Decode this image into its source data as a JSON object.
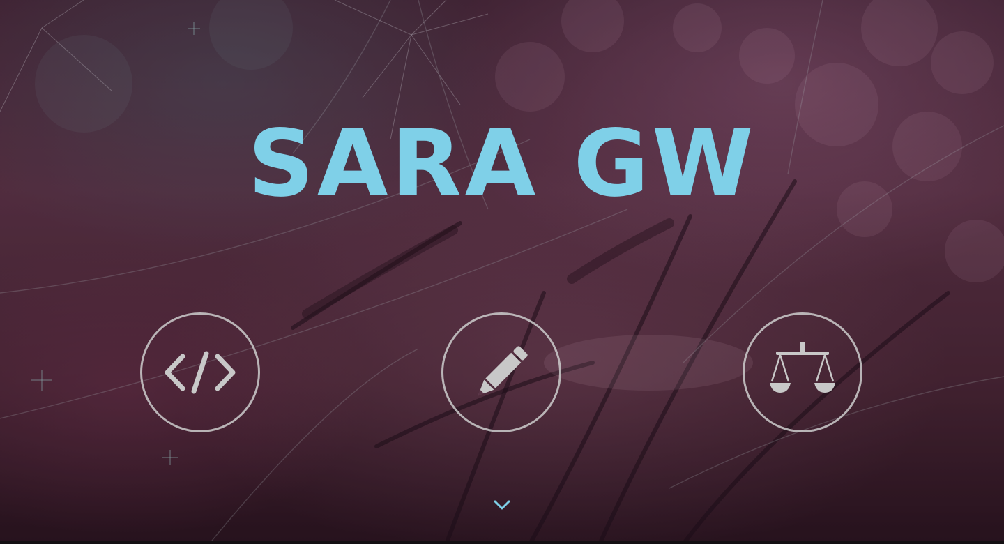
{
  "hero": {
    "title": "SARA GW",
    "title_color": "#7fd0e8"
  },
  "icons": [
    {
      "name": "code-icon",
      "glyph": "</>"
    },
    {
      "name": "pencil-icon"
    },
    {
      "name": "scales-icon"
    }
  ],
  "scroll": {
    "icon": "chevron-down-icon",
    "color": "#7fd0e8"
  },
  "colors": {
    "icon_stroke": "#cdcdcd",
    "icon_fill": "#c8c8c8"
  }
}
